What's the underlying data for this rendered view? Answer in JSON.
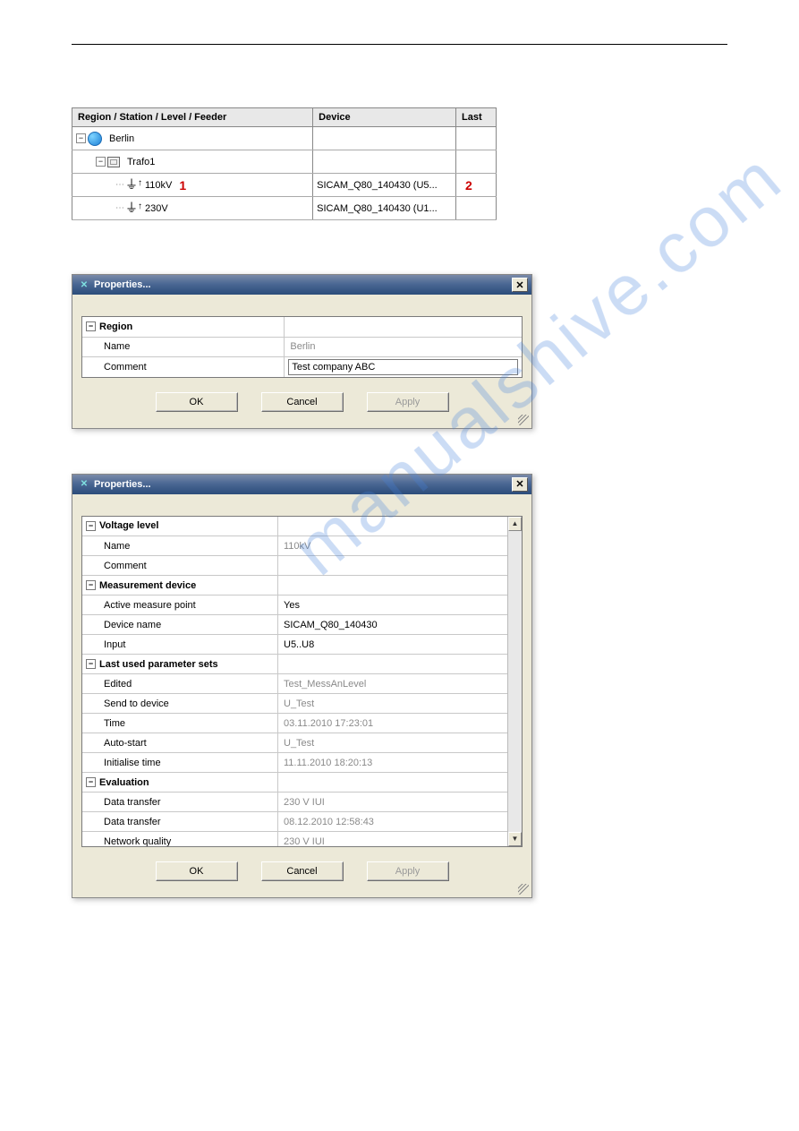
{
  "watermark": "manualshive.com",
  "tree": {
    "headers": {
      "col1": "Region / Station / Level / Feeder",
      "col2": "Device",
      "col3": "Last"
    },
    "rows": [
      {
        "indent": 0,
        "expander": "-",
        "iconType": "globe",
        "label": "Berlin",
        "device": "",
        "marker": ""
      },
      {
        "indent": 1,
        "expander": "-",
        "iconType": "folder",
        "label": "Trafo1",
        "device": "",
        "marker": ""
      },
      {
        "indent": 2,
        "expander": "",
        "iconType": "level",
        "label": "110kV",
        "device": "SICAM_Q80_140430 (U5...",
        "marker": "1",
        "marker2": "2"
      },
      {
        "indent": 2,
        "expander": "",
        "iconType": "level",
        "label": "230V",
        "device": "SICAM_Q80_140430 (U1...",
        "marker": ""
      }
    ]
  },
  "dialog1": {
    "title": "Properties...",
    "section": "Region",
    "rows": {
      "name": {
        "label": "Name",
        "value": "Berlin",
        "readonly": true
      },
      "comment": {
        "label": "Comment",
        "value": "Test company ABC",
        "input": true
      }
    },
    "buttons": {
      "ok": "OK",
      "cancel": "Cancel",
      "apply": "Apply"
    }
  },
  "dialog2": {
    "title": "Properties...",
    "sections": [
      {
        "title": "Voltage level",
        "rows": [
          {
            "label": "Name",
            "value": "110kV",
            "readonly": true
          },
          {
            "label": "Comment",
            "value": "",
            "readonly": false
          }
        ]
      },
      {
        "title": "Measurement device",
        "rows": [
          {
            "label": "Active measure point",
            "value": "Yes",
            "readonly": false
          },
          {
            "label": "Device name",
            "value": "SICAM_Q80_140430",
            "readonly": false
          },
          {
            "label": "Input",
            "value": "U5..U8",
            "readonly": false
          }
        ]
      },
      {
        "title": "Last used parameter sets",
        "rows": [
          {
            "label": "Edited",
            "value": "Test_MessAnLevel",
            "readonly": true
          },
          {
            "label": "Send to device",
            "value": "U_Test",
            "readonly": true
          },
          {
            "label": "Time",
            "value": "03.11.2010 17:23:01",
            "readonly": true
          },
          {
            "label": "Auto-start",
            "value": "U_Test",
            "readonly": true
          },
          {
            "label": "Initialise time",
            "value": "11.11.2010 18:20:13",
            "readonly": true
          }
        ]
      },
      {
        "title": "Evaluation",
        "rows": [
          {
            "label": "Data transfer",
            "value": "230 V IUI",
            "readonly": true
          },
          {
            "label": "Data transfer",
            "value": "08.12.2010 12:58:43",
            "readonly": true
          },
          {
            "label": "Network quality",
            "value": "230 V IUI",
            "readonly": true
          }
        ]
      }
    ],
    "buttons": {
      "ok": "OK",
      "cancel": "Cancel",
      "apply": "Apply"
    }
  }
}
